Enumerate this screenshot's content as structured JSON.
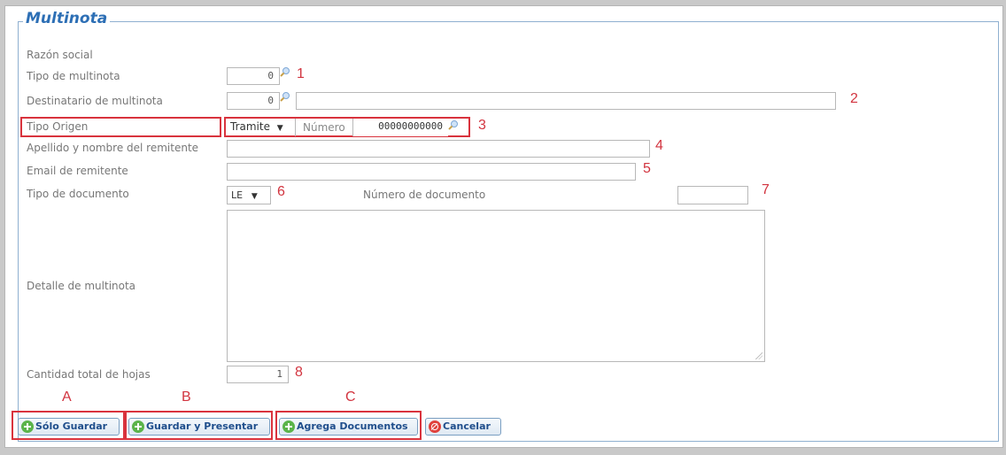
{
  "form": {
    "title": "Multinota",
    "labels": {
      "razon_social": "Razón social",
      "tipo_multinota": "Tipo de multinota",
      "destinatario": "Destinatario de multinota",
      "tipo_origen": "Tipo Origen",
      "numero": "Número",
      "apellido_nombre": "Apellido y nombre del remitente",
      "email": "Email de remitente",
      "tipo_documento": "Tipo de documento",
      "numero_documento": "Número de documento",
      "detalle": "Detalle de multinota",
      "cantidad_hojas": "Cantidad total de hojas"
    },
    "values": {
      "tipo_multinota": "0",
      "destinatario": "0",
      "destinatario_nombre": "",
      "tipo_origen": "Tramite",
      "numero": "00000000000",
      "apellido_nombre": "",
      "email": "",
      "tipo_documento": "LE",
      "numero_documento": "",
      "detalle": "",
      "cantidad_hojas": "1"
    }
  },
  "markers": {
    "m1": "1",
    "m2": "2",
    "m3": "3",
    "m4": "4",
    "m5": "5",
    "m6": "6",
    "m7": "7",
    "m8": "8",
    "a": "A",
    "b": "B",
    "c": "C"
  },
  "buttons": {
    "solo_guardar": "Sólo Guardar",
    "guardar_presentar": "Guardar y Presentar",
    "agrega_documentos": "Agrega Documentos",
    "cancelar": "Cancelar"
  },
  "colors": {
    "accent": "#2d6fb5",
    "annotation": "#d9333d",
    "add_icon": "#5bb44a",
    "cancel_icon": "#e0413c"
  },
  "icons": [
    "magnifier-icon",
    "add-circle-icon",
    "cancel-circle-icon",
    "dropdown-arrow-icon"
  ]
}
